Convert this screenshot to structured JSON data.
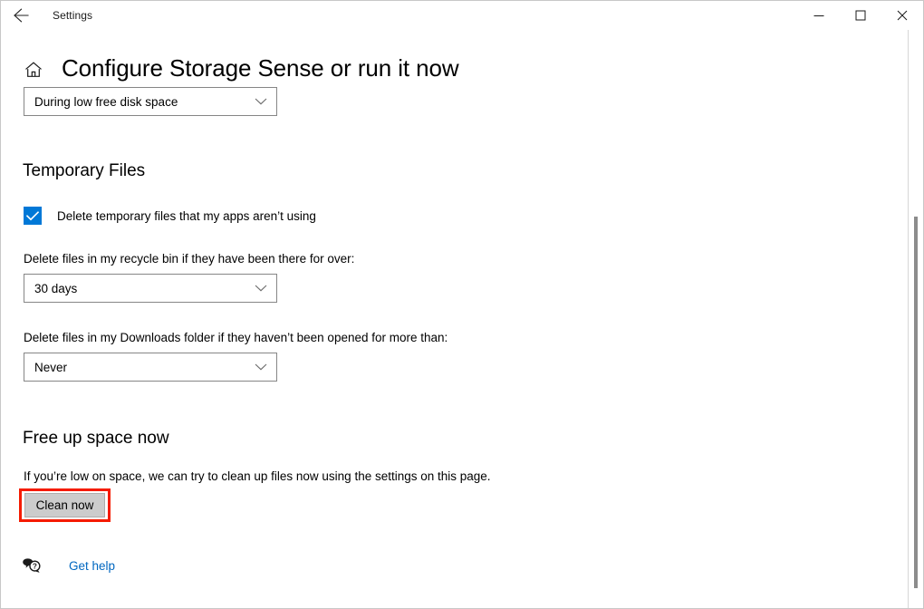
{
  "window": {
    "app_title": "Settings",
    "back_icon": "back-arrow-icon",
    "minimize_label": "Minimize",
    "maximize_label": "Maximize",
    "close_label": "Close"
  },
  "header": {
    "home_icon": "home-icon",
    "page_title": "Configure Storage Sense or run it now"
  },
  "schedule": {
    "selected": "During low free disk space"
  },
  "temporary_files": {
    "heading": "Temporary Files",
    "checkbox_label": "Delete temporary files that my apps aren’t using",
    "checkbox_checked": true,
    "recycle_label": "Delete files in my recycle bin if they have been there for over:",
    "recycle_selected": "30 days",
    "downloads_label": "Delete files in my Downloads folder if they haven’t been opened for more than:",
    "downloads_selected": "Never"
  },
  "free_up_space": {
    "heading": "Free up space now",
    "description": "If you’re low on space, we can try to clean up files now using the settings on this page.",
    "button_label": "Clean now",
    "button_highlighted": true
  },
  "footer": {
    "help_icon": "help-speech-bubble-icon",
    "help_label": "Get help"
  },
  "colors": {
    "accent": "#0078d7",
    "link": "#0067c0",
    "annotation": "#f51b00",
    "button_face": "#cccccc",
    "combo_border": "#868686",
    "scrollbar_thumb": "#8c8c8c"
  }
}
